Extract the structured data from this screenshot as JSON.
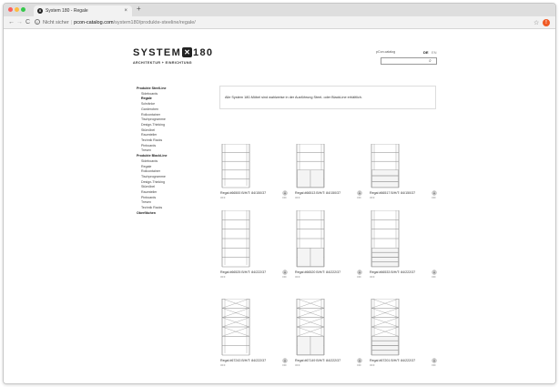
{
  "browser": {
    "tab_title": "System 180 - Regale",
    "tab_favicon": "X",
    "tab_close": "×",
    "new_tab": "+",
    "nav_back": "←",
    "nav_forward": "→",
    "nav_reload": "C",
    "url_info": "i",
    "url_insecure": "Nicht sicher",
    "url_separator": "|",
    "url_domain": "pcon-catalog.com",
    "url_path": "/system180/produkte-steeline/regale/",
    "star": "☆",
    "extension_badge": "!",
    "menu": "⋮"
  },
  "header": {
    "logo_left": "SYSTEM",
    "logo_x": "✕",
    "logo_right": "180",
    "tagline": "ARCHITEKTUR + EINRICHTUNG",
    "pcon_link": "pCon.catalog",
    "lang_de": "DE",
    "lang_en": "EN",
    "search_icon": "⌕",
    "search_value": ""
  },
  "sidebar": {
    "items": [
      {
        "label": "Produkte SteelLine",
        "level": 1,
        "active": false
      },
      {
        "label": "Sideboards",
        "level": 2,
        "active": false
      },
      {
        "label": "Regale",
        "level": 2,
        "active": true
      },
      {
        "label": "Schränke",
        "level": 2,
        "active": false
      },
      {
        "label": "Garderoben",
        "level": 2,
        "active": false
      },
      {
        "label": "Rollcontainer",
        "level": 2,
        "active": false
      },
      {
        "label": "Tischprogramme",
        "level": 2,
        "active": false
      },
      {
        "label": "Design-Thinking",
        "level": 2,
        "active": false
      },
      {
        "label": "Stümöbel",
        "level": 2,
        "active": false
      },
      {
        "label": "Raumteiler",
        "level": 2,
        "active": false
      },
      {
        "label": "Technik Racks",
        "level": 2,
        "active": false
      },
      {
        "label": "Pinboards",
        "level": 2,
        "active": false
      },
      {
        "label": "Tresen",
        "level": 2,
        "active": false
      },
      {
        "label": "Produkte BlackLine",
        "level": 1,
        "active": false
      },
      {
        "label": "Sideboards",
        "level": 2,
        "active": false
      },
      {
        "label": "Regale",
        "level": 2,
        "active": false
      },
      {
        "label": "Rollcontainer",
        "level": 2,
        "active": false
      },
      {
        "label": "Tischprogramme",
        "level": 2,
        "active": false
      },
      {
        "label": "Design-Thinking",
        "level": 2,
        "active": false
      },
      {
        "label": "Stümöbel",
        "level": 2,
        "active": false
      },
      {
        "label": "Raumteiler",
        "level": 2,
        "active": false
      },
      {
        "label": "Pinboards",
        "level": 2,
        "active": false
      },
      {
        "label": "Tresen",
        "level": 2,
        "active": false
      },
      {
        "label": "Technik Racks",
        "level": 2,
        "active": false
      },
      {
        "label": "Oberflächen",
        "level": 1,
        "active": false
      }
    ]
  },
  "intro": {
    "text": "Alle System 180-Möbel sind wahlweise in der Ausführung Steel- oder BlackLine erhältlich."
  },
  "products": [
    {
      "label": "Regal #66500 B/H/T: 84/150/37",
      "sub": "OFF",
      "download": "OFF",
      "style": "open",
      "tall": false
    },
    {
      "label": "Regal #66513 B/H/T: 84/150/37",
      "sub": "OFF",
      "download": "OFF",
      "style": "doors",
      "tall": false
    },
    {
      "label": "Regal #66517 B/H/T: 84/150/37",
      "sub": "OFF",
      "download": "OFF",
      "style": "drawers",
      "tall": false
    },
    {
      "label": "Regal #66525 B/H/T: 84/222/37",
      "sub": "OFF",
      "download": "OFF",
      "style": "open",
      "tall": true
    },
    {
      "label": "Regal #66520 B/H/T: 84/222/37",
      "sub": "OFF",
      "download": "OFF",
      "style": "doors",
      "tall": true
    },
    {
      "label": "Regal #66533 B/H/T: 84/222/37",
      "sub": "OFF",
      "download": "OFF",
      "style": "drawers",
      "tall": true
    },
    {
      "label": "Regal #67243 B/H/T: 84/222/37",
      "sub": "OFF",
      "download": "OFF",
      "style": "cross-open",
      "tall": true
    },
    {
      "label": "Regal #67149 B/H/T: 84/222/37",
      "sub": "OFF",
      "download": "OFF",
      "style": "cross-doors",
      "tall": true
    },
    {
      "label": "Regal #67201 B/H/T: 84/222/37",
      "sub": "OFF",
      "download": "OFF",
      "style": "cross-drawers",
      "tall": true
    }
  ]
}
